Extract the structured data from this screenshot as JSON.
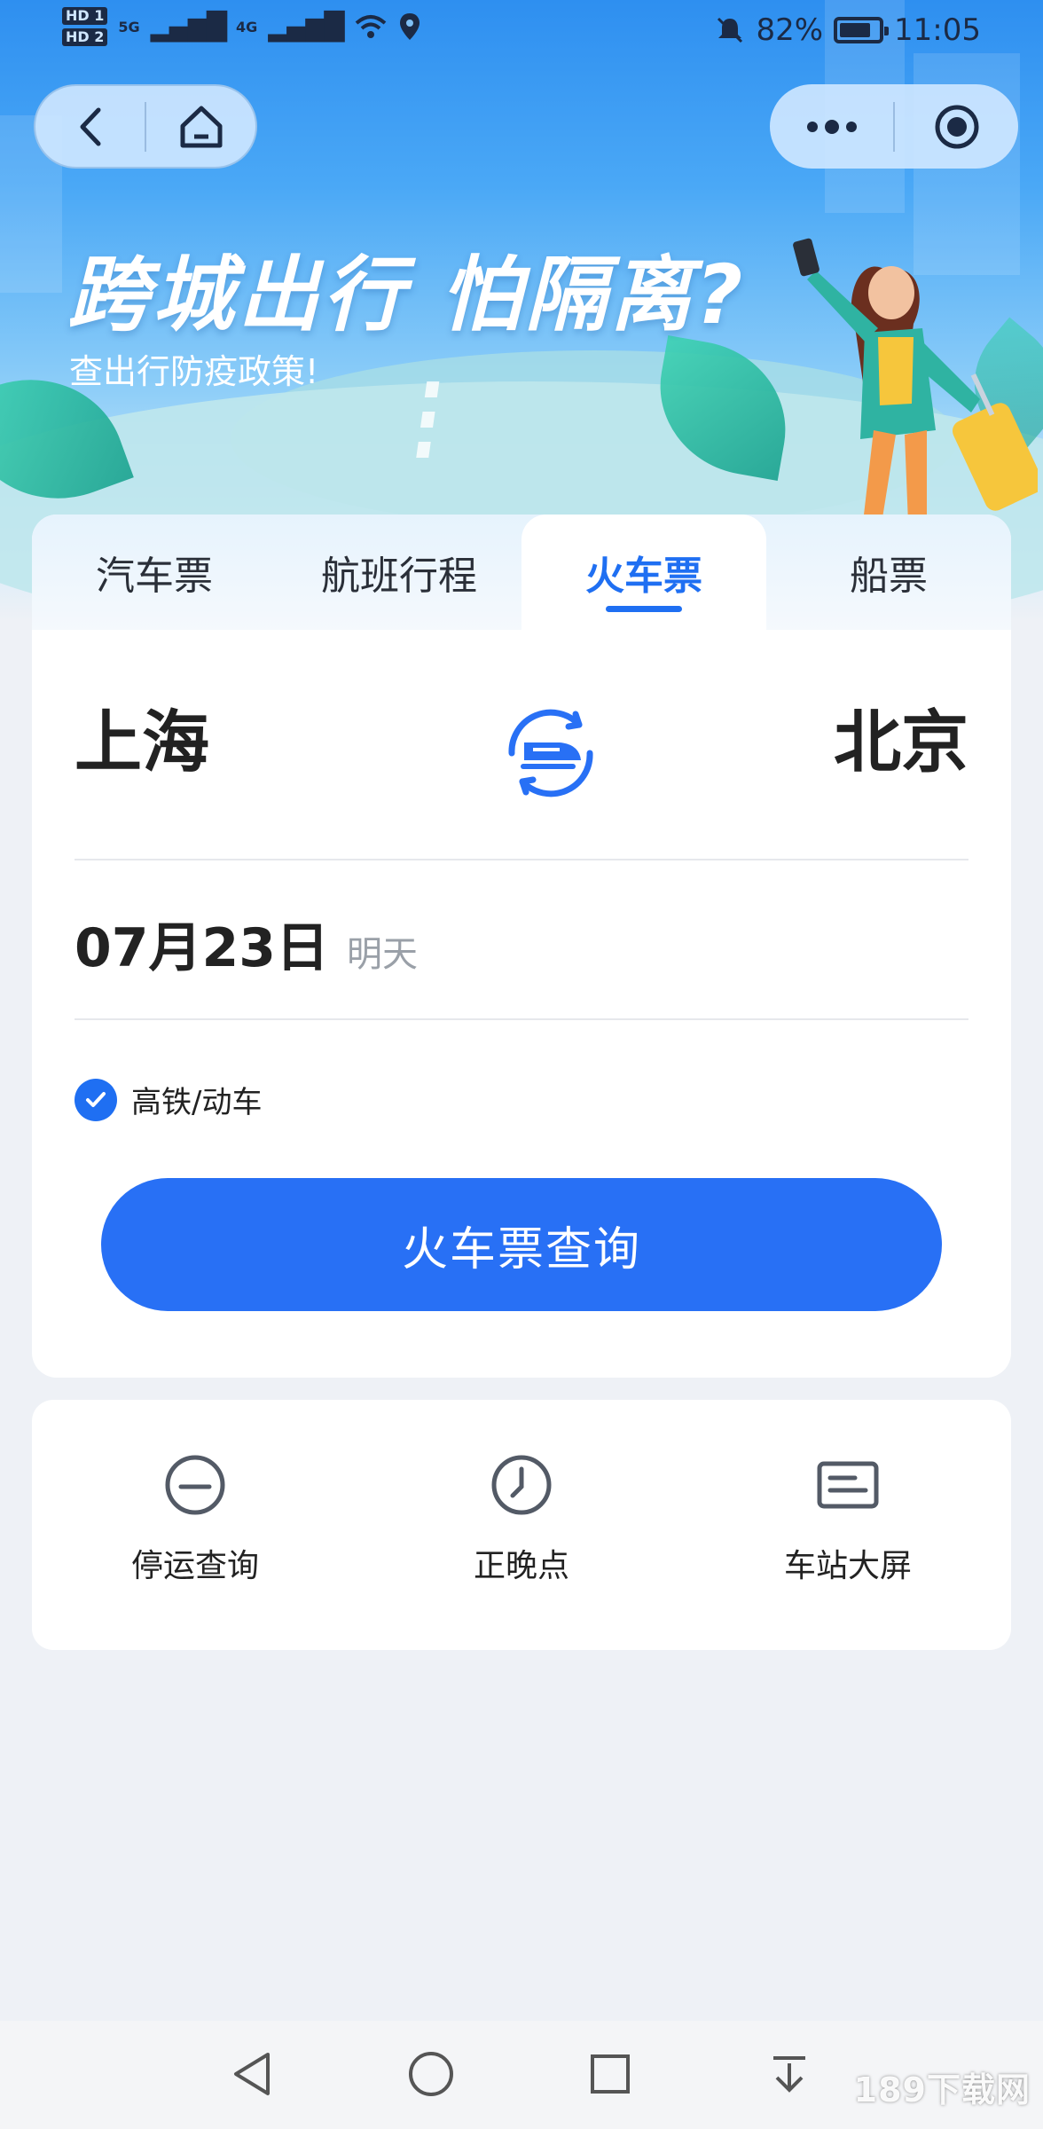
{
  "status_bar": {
    "hd1": "HD 1",
    "hd2": "HD 2",
    "net1": "5G",
    "net2": "4G",
    "battery_text": "82%",
    "battery_level": 0.82,
    "time": "11:05"
  },
  "hero": {
    "title": "跨城出行 怕隔离?",
    "subtitle": "查出行防疫政策!"
  },
  "tabs": [
    {
      "label": "汽车票",
      "active": false
    },
    {
      "label": "航班行程",
      "active": false
    },
    {
      "label": "火车票",
      "active": true
    },
    {
      "label": "船票",
      "active": false
    }
  ],
  "route": {
    "from": "上海",
    "to": "北京"
  },
  "date": {
    "value": "07月23日",
    "day": "明天"
  },
  "option": {
    "label": "高铁/动车",
    "checked": true
  },
  "search_button": "火车票查询",
  "quick_links": [
    {
      "label": "停运查询",
      "icon": "suspension-icon"
    },
    {
      "label": "正晚点",
      "icon": "clock-icon"
    },
    {
      "label": "车站大屏",
      "icon": "station-board-icon"
    }
  ],
  "watermark": "189下载网",
  "colors": {
    "accent": "#1f6ff2",
    "button": "#2870f5",
    "hero_top": "#2e8ff0"
  }
}
